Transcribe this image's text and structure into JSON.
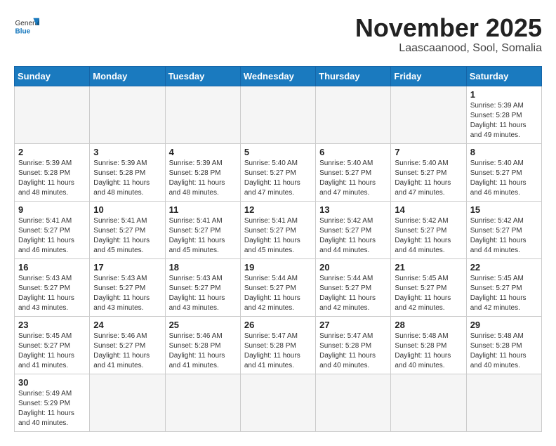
{
  "header": {
    "logo_general": "General",
    "logo_blue": "Blue",
    "month_title": "November 2025",
    "location": "Laascaanood, Sool, Somalia"
  },
  "weekdays": [
    "Sunday",
    "Monday",
    "Tuesday",
    "Wednesday",
    "Thursday",
    "Friday",
    "Saturday"
  ],
  "days": [
    {
      "num": "",
      "sunrise": "",
      "sunset": "",
      "daylight": "",
      "empty": true
    },
    {
      "num": "",
      "sunrise": "",
      "sunset": "",
      "daylight": "",
      "empty": true
    },
    {
      "num": "",
      "sunrise": "",
      "sunset": "",
      "daylight": "",
      "empty": true
    },
    {
      "num": "",
      "sunrise": "",
      "sunset": "",
      "daylight": "",
      "empty": true
    },
    {
      "num": "",
      "sunrise": "",
      "sunset": "",
      "daylight": "",
      "empty": true
    },
    {
      "num": "",
      "sunrise": "",
      "sunset": "",
      "daylight": "",
      "empty": true
    },
    {
      "num": "1",
      "sunrise": "Sunrise: 5:39 AM",
      "sunset": "Sunset: 5:28 PM",
      "daylight": "Daylight: 11 hours and 49 minutes.",
      "empty": false
    },
    {
      "num": "2",
      "sunrise": "Sunrise: 5:39 AM",
      "sunset": "Sunset: 5:28 PM",
      "daylight": "Daylight: 11 hours and 48 minutes.",
      "empty": false
    },
    {
      "num": "3",
      "sunrise": "Sunrise: 5:39 AM",
      "sunset": "Sunset: 5:28 PM",
      "daylight": "Daylight: 11 hours and 48 minutes.",
      "empty": false
    },
    {
      "num": "4",
      "sunrise": "Sunrise: 5:39 AM",
      "sunset": "Sunset: 5:28 PM",
      "daylight": "Daylight: 11 hours and 48 minutes.",
      "empty": false
    },
    {
      "num": "5",
      "sunrise": "Sunrise: 5:40 AM",
      "sunset": "Sunset: 5:27 PM",
      "daylight": "Daylight: 11 hours and 47 minutes.",
      "empty": false
    },
    {
      "num": "6",
      "sunrise": "Sunrise: 5:40 AM",
      "sunset": "Sunset: 5:27 PM",
      "daylight": "Daylight: 11 hours and 47 minutes.",
      "empty": false
    },
    {
      "num": "7",
      "sunrise": "Sunrise: 5:40 AM",
      "sunset": "Sunset: 5:27 PM",
      "daylight": "Daylight: 11 hours and 47 minutes.",
      "empty": false
    },
    {
      "num": "8",
      "sunrise": "Sunrise: 5:40 AM",
      "sunset": "Sunset: 5:27 PM",
      "daylight": "Daylight: 11 hours and 46 minutes.",
      "empty": false
    },
    {
      "num": "9",
      "sunrise": "Sunrise: 5:41 AM",
      "sunset": "Sunset: 5:27 PM",
      "daylight": "Daylight: 11 hours and 46 minutes.",
      "empty": false
    },
    {
      "num": "10",
      "sunrise": "Sunrise: 5:41 AM",
      "sunset": "Sunset: 5:27 PM",
      "daylight": "Daylight: 11 hours and 45 minutes.",
      "empty": false
    },
    {
      "num": "11",
      "sunrise": "Sunrise: 5:41 AM",
      "sunset": "Sunset: 5:27 PM",
      "daylight": "Daylight: 11 hours and 45 minutes.",
      "empty": false
    },
    {
      "num": "12",
      "sunrise": "Sunrise: 5:41 AM",
      "sunset": "Sunset: 5:27 PM",
      "daylight": "Daylight: 11 hours and 45 minutes.",
      "empty": false
    },
    {
      "num": "13",
      "sunrise": "Sunrise: 5:42 AM",
      "sunset": "Sunset: 5:27 PM",
      "daylight": "Daylight: 11 hours and 44 minutes.",
      "empty": false
    },
    {
      "num": "14",
      "sunrise": "Sunrise: 5:42 AM",
      "sunset": "Sunset: 5:27 PM",
      "daylight": "Daylight: 11 hours and 44 minutes.",
      "empty": false
    },
    {
      "num": "15",
      "sunrise": "Sunrise: 5:42 AM",
      "sunset": "Sunset: 5:27 PM",
      "daylight": "Daylight: 11 hours and 44 minutes.",
      "empty": false
    },
    {
      "num": "16",
      "sunrise": "Sunrise: 5:43 AM",
      "sunset": "Sunset: 5:27 PM",
      "daylight": "Daylight: 11 hours and 43 minutes.",
      "empty": false
    },
    {
      "num": "17",
      "sunrise": "Sunrise: 5:43 AM",
      "sunset": "Sunset: 5:27 PM",
      "daylight": "Daylight: 11 hours and 43 minutes.",
      "empty": false
    },
    {
      "num": "18",
      "sunrise": "Sunrise: 5:43 AM",
      "sunset": "Sunset: 5:27 PM",
      "daylight": "Daylight: 11 hours and 43 minutes.",
      "empty": false
    },
    {
      "num": "19",
      "sunrise": "Sunrise: 5:44 AM",
      "sunset": "Sunset: 5:27 PM",
      "daylight": "Daylight: 11 hours and 42 minutes.",
      "empty": false
    },
    {
      "num": "20",
      "sunrise": "Sunrise: 5:44 AM",
      "sunset": "Sunset: 5:27 PM",
      "daylight": "Daylight: 11 hours and 42 minutes.",
      "empty": false
    },
    {
      "num": "21",
      "sunrise": "Sunrise: 5:45 AM",
      "sunset": "Sunset: 5:27 PM",
      "daylight": "Daylight: 11 hours and 42 minutes.",
      "empty": false
    },
    {
      "num": "22",
      "sunrise": "Sunrise: 5:45 AM",
      "sunset": "Sunset: 5:27 PM",
      "daylight": "Daylight: 11 hours and 42 minutes.",
      "empty": false
    },
    {
      "num": "23",
      "sunrise": "Sunrise: 5:45 AM",
      "sunset": "Sunset: 5:27 PM",
      "daylight": "Daylight: 11 hours and 41 minutes.",
      "empty": false
    },
    {
      "num": "24",
      "sunrise": "Sunrise: 5:46 AM",
      "sunset": "Sunset: 5:27 PM",
      "daylight": "Daylight: 11 hours and 41 minutes.",
      "empty": false
    },
    {
      "num": "25",
      "sunrise": "Sunrise: 5:46 AM",
      "sunset": "Sunset: 5:28 PM",
      "daylight": "Daylight: 11 hours and 41 minutes.",
      "empty": false
    },
    {
      "num": "26",
      "sunrise": "Sunrise: 5:47 AM",
      "sunset": "Sunset: 5:28 PM",
      "daylight": "Daylight: 11 hours and 41 minutes.",
      "empty": false
    },
    {
      "num": "27",
      "sunrise": "Sunrise: 5:47 AM",
      "sunset": "Sunset: 5:28 PM",
      "daylight": "Daylight: 11 hours and 40 minutes.",
      "empty": false
    },
    {
      "num": "28",
      "sunrise": "Sunrise: 5:48 AM",
      "sunset": "Sunset: 5:28 PM",
      "daylight": "Daylight: 11 hours and 40 minutes.",
      "empty": false
    },
    {
      "num": "29",
      "sunrise": "Sunrise: 5:48 AM",
      "sunset": "Sunset: 5:28 PM",
      "daylight": "Daylight: 11 hours and 40 minutes.",
      "empty": false
    },
    {
      "num": "30",
      "sunrise": "Sunrise: 5:49 AM",
      "sunset": "Sunset: 5:29 PM",
      "daylight": "Daylight: 11 hours and 40 minutes.",
      "empty": false
    },
    {
      "num": "",
      "sunrise": "",
      "sunset": "",
      "daylight": "",
      "empty": true
    },
    {
      "num": "",
      "sunrise": "",
      "sunset": "",
      "daylight": "",
      "empty": true
    },
    {
      "num": "",
      "sunrise": "",
      "sunset": "",
      "daylight": "",
      "empty": true
    },
    {
      "num": "",
      "sunrise": "",
      "sunset": "",
      "daylight": "",
      "empty": true
    },
    {
      "num": "",
      "sunrise": "",
      "sunset": "",
      "daylight": "",
      "empty": true
    },
    {
      "num": "",
      "sunrise": "",
      "sunset": "",
      "daylight": "",
      "empty": true
    }
  ]
}
